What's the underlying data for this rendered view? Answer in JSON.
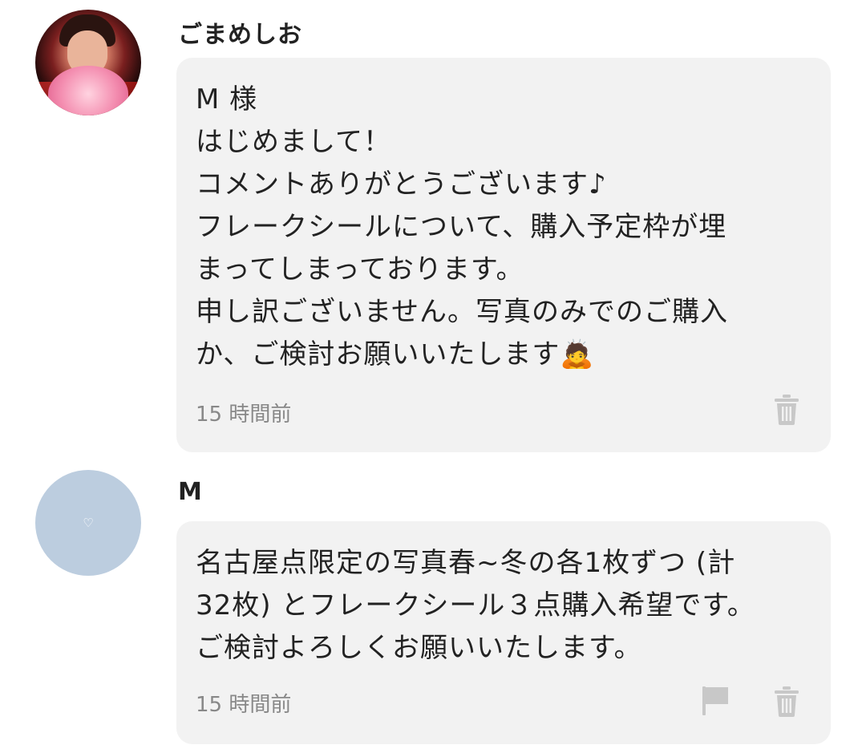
{
  "comments": [
    {
      "username": "ごまめしお",
      "avatar_icon": "user-photo-avatar",
      "message": "M 様\nはじめまして！\nコメントありがとうございます♪\nフレークシールについて、購入予定枠が埋\nまってしまっております。\n申し訳ございません。写真のみでのご購入\nか、ご検討お願いいたします🙇",
      "timestamp": "15 時間前",
      "actions": [
        "trash-icon"
      ]
    },
    {
      "username": "M",
      "avatar_icon": "heart-icon",
      "avatar_glyph": "♡",
      "message": "名古屋点限定の写真春~冬の各1枚ずつ (計\n32枚) とフレークシール３点購入希望です。\nご検討よろしくお願いいたします。",
      "timestamp": "15 時間前",
      "actions": [
        "flag-icon",
        "trash-icon"
      ]
    }
  ],
  "colors": {
    "bubble_bg": "#f2f2f2",
    "icon_gray": "#c8c8c8",
    "timestamp": "#888888",
    "avatar_plain": "#bccddf"
  }
}
